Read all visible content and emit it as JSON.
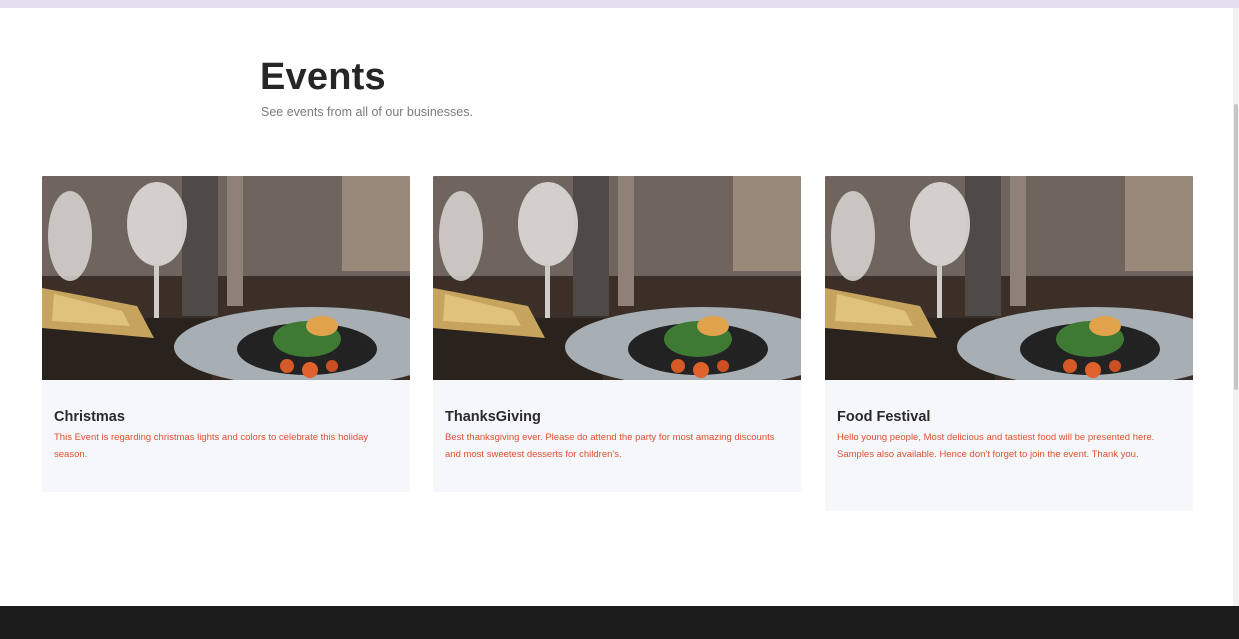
{
  "header": {
    "title": "Events",
    "subtitle": "See events from all of our businesses."
  },
  "events": [
    {
      "title": "Christmas",
      "description": "This Event is regarding christmas lights and colors to celebrate this holiday season."
    },
    {
      "title": "ThanksGiving",
      "description": "Best thanksgiving ever. Please do attend the party for most amazing discounts and most sweetest desserts for children's."
    },
    {
      "title": "Food Festival",
      "description": "Hello young people, Most delicious and tastiest food will be presented here. Samples also available. Hence don't forget to join the event. Thank you."
    }
  ],
  "colors": {
    "accent_text": "#e0502f",
    "card_background": "#f6f7fa",
    "footer": "#1c1c1c",
    "top_border": "#e4dff0"
  },
  "icons": {
    "event_image": "restaurant-table-photo"
  }
}
